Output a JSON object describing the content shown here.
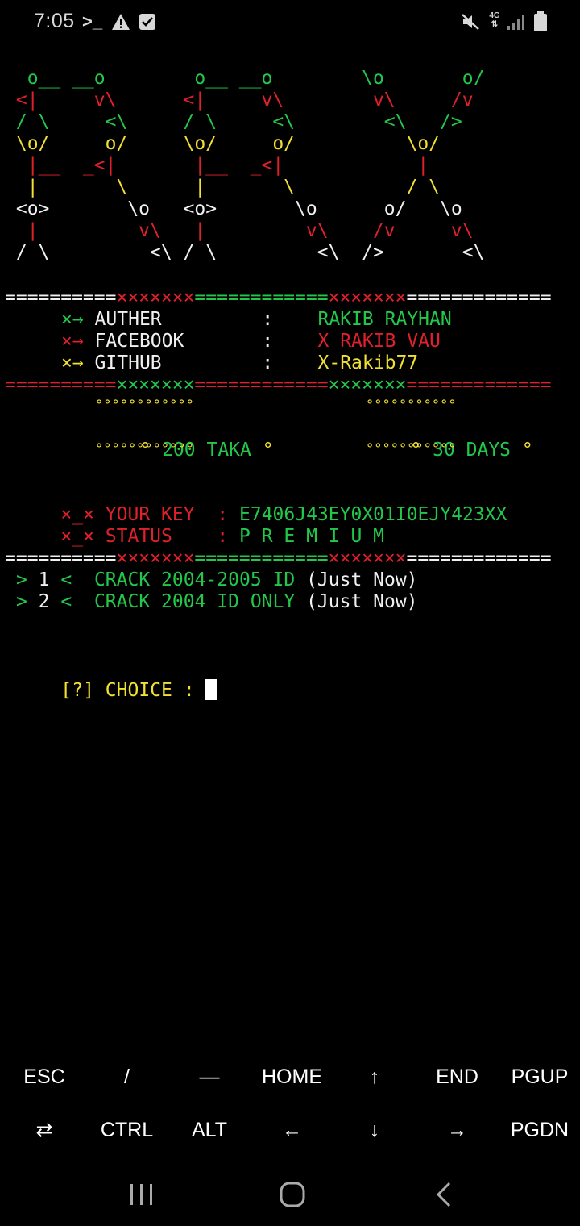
{
  "status_bar": {
    "time": "7:05",
    "icons": [
      "terminal-icon",
      "warning-icon",
      "check-box-icon"
    ],
    "right_icons": [
      "mute-icon",
      "4g-network-icon",
      "signal-icon",
      "battery-icon"
    ],
    "network_label": "4G"
  },
  "banner": [
    {
      "segments": [
        {
          "t": "  o__ __o        o__ __o        \\o       o/",
          "c": "g"
        }
      ]
    },
    {
      "segments": [
        {
          "t": " <|     v\\      <|     v\\        v\\     /v",
          "c": "r"
        }
      ]
    },
    {
      "segments": [
        {
          "t": " / \\     <\\     / \\     <\\        <\\   />",
          "c": "g"
        }
      ]
    },
    {
      "segments": [
        {
          "t": " \\o/     o/     \\o/     o/          \\o/",
          "c": "y"
        }
      ]
    },
    {
      "segments": [
        {
          "t": "  |__  _<|       |__  _<|            |",
          "c": "r"
        }
      ]
    },
    {
      "segments": [
        {
          "t": "  |       \\      |       \\          / \\",
          "c": "y"
        }
      ]
    },
    {
      "segments": [
        {
          "t": " <o>       \\o   <o>       \\o      o/   \\o",
          "c": "w"
        }
      ]
    },
    {
      "segments": [
        {
          "t": "  |         v\\   |         v\\    /v     v\\",
          "c": "r"
        }
      ]
    },
    {
      "segments": [
        {
          "t": " / \\         <\\ / \\         <\\  />       <\\",
          "c": "w"
        }
      ]
    }
  ],
  "separator_1": [
    {
      "t": "==========",
      "c": "w"
    },
    {
      "t": "×××××××",
      "c": "r"
    },
    {
      "t": "============",
      "c": "g"
    },
    {
      "t": "×××××××",
      "c": "r"
    },
    {
      "t": "=============",
      "c": "w"
    }
  ],
  "info": [
    {
      "marker": "×→",
      "marker_c": "g",
      "label": "AUTHER",
      "value": "RAKIB RAYHAN",
      "value_c": "g"
    },
    {
      "marker": "×→",
      "marker_c": "r",
      "label": "FACEBOOK",
      "value": "X RAKIB VAU",
      "value_c": "r"
    },
    {
      "marker": "×→",
      "marker_c": "y",
      "label": "GITHUB",
      "value": "X-Rakib77",
      "value_c": "y"
    }
  ],
  "separator_2": [
    {
      "t": "==========",
      "c": "r"
    },
    {
      "t": "×××××××",
      "c": "g"
    },
    {
      "t": "============",
      "c": "r"
    },
    {
      "t": "×××××××",
      "c": "g"
    },
    {
      "t": "=============",
      "c": "r"
    }
  ],
  "price": {
    "dots_left": "°°°°°°°°°°°°",
    "dots_right": "°°°°°°°°°°°",
    "left": "° 200 TAKA °",
    "right": "° 30 DAYS °"
  },
  "key_info": {
    "marker": "×_×",
    "key_label": "YOUR KEY",
    "key_value": "E7406J43EY0X01I0EJY423XX",
    "status_label": "STATUS",
    "status_value": "P R E M I U M"
  },
  "separator_3": [
    {
      "t": "==========",
      "c": "w"
    },
    {
      "t": "×××××××",
      "c": "r"
    },
    {
      "t": "============",
      "c": "g"
    },
    {
      "t": "×××××××",
      "c": "r"
    },
    {
      "t": "=============",
      "c": "w"
    }
  ],
  "menu": [
    {
      "num": "1",
      "text": "CRACK 2004-2005 ID",
      "suffix": "(Just Now)"
    },
    {
      "num": "2",
      "text": "CRACK 2004 ID ONLY",
      "suffix": "(Just Now)"
    }
  ],
  "prompt": "[?] CHOICE : ",
  "extra_keys": {
    "row1": [
      "ESC",
      "/",
      "—",
      "HOME",
      "↑",
      "END",
      "PGUP"
    ],
    "row2": [
      "⇄",
      "CTRL",
      "ALT",
      "←",
      "↓",
      "→",
      "PGDN"
    ]
  },
  "colors": {
    "green": "#22c84a",
    "red": "#e0212b",
    "yellow": "#f2e132",
    "white": "#f0f0f0"
  }
}
